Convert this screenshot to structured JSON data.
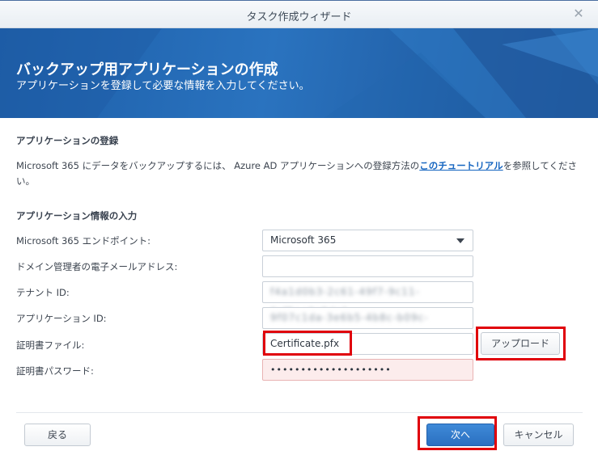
{
  "window": {
    "title": "タスク作成ウィザード",
    "close_glyph": "✕"
  },
  "banner": {
    "heading": "バックアップ用アプリケーションの作成",
    "subheading": "アプリケーションを登録して必要な情報を入力してください。"
  },
  "register": {
    "title": "アプリケーションの登録",
    "text_before": "Microsoft 365 にデータをバックアップするには、 Azure AD アプリケーションへの登録方法の",
    "link": "このチュートリアル",
    "text_after": "を参照してください。"
  },
  "info": {
    "title": "アプリケーション情報の入力",
    "endpoint_label": "Microsoft 365 エンドポイント:",
    "endpoint_value": "Microsoft 365",
    "email_label": "ドメイン管理者の電子メールアドレス:",
    "email_value": "",
    "tenant_label": "テナント ID:",
    "tenant_value": "f4a1d0b3-2c61-49f7-9c11-0cf5ae0c8da1",
    "app_label": "アプリケーション ID:",
    "app_value": "9f07c1da-3e6b5-4b8c-b09c-2d0731e2d7f4",
    "cert_label": "証明書ファイル:",
    "cert_value": "Certificate.pfx",
    "upload_label": "アップロード",
    "password_label": "証明書パスワード:",
    "password_value": "••••••••••••••••••••"
  },
  "footer": {
    "back_label": "戻る",
    "next_label": "次へ",
    "cancel_label": "キャンセル"
  },
  "colors": {
    "accent": "#2a6fc0",
    "highlight": "#e0000a"
  }
}
